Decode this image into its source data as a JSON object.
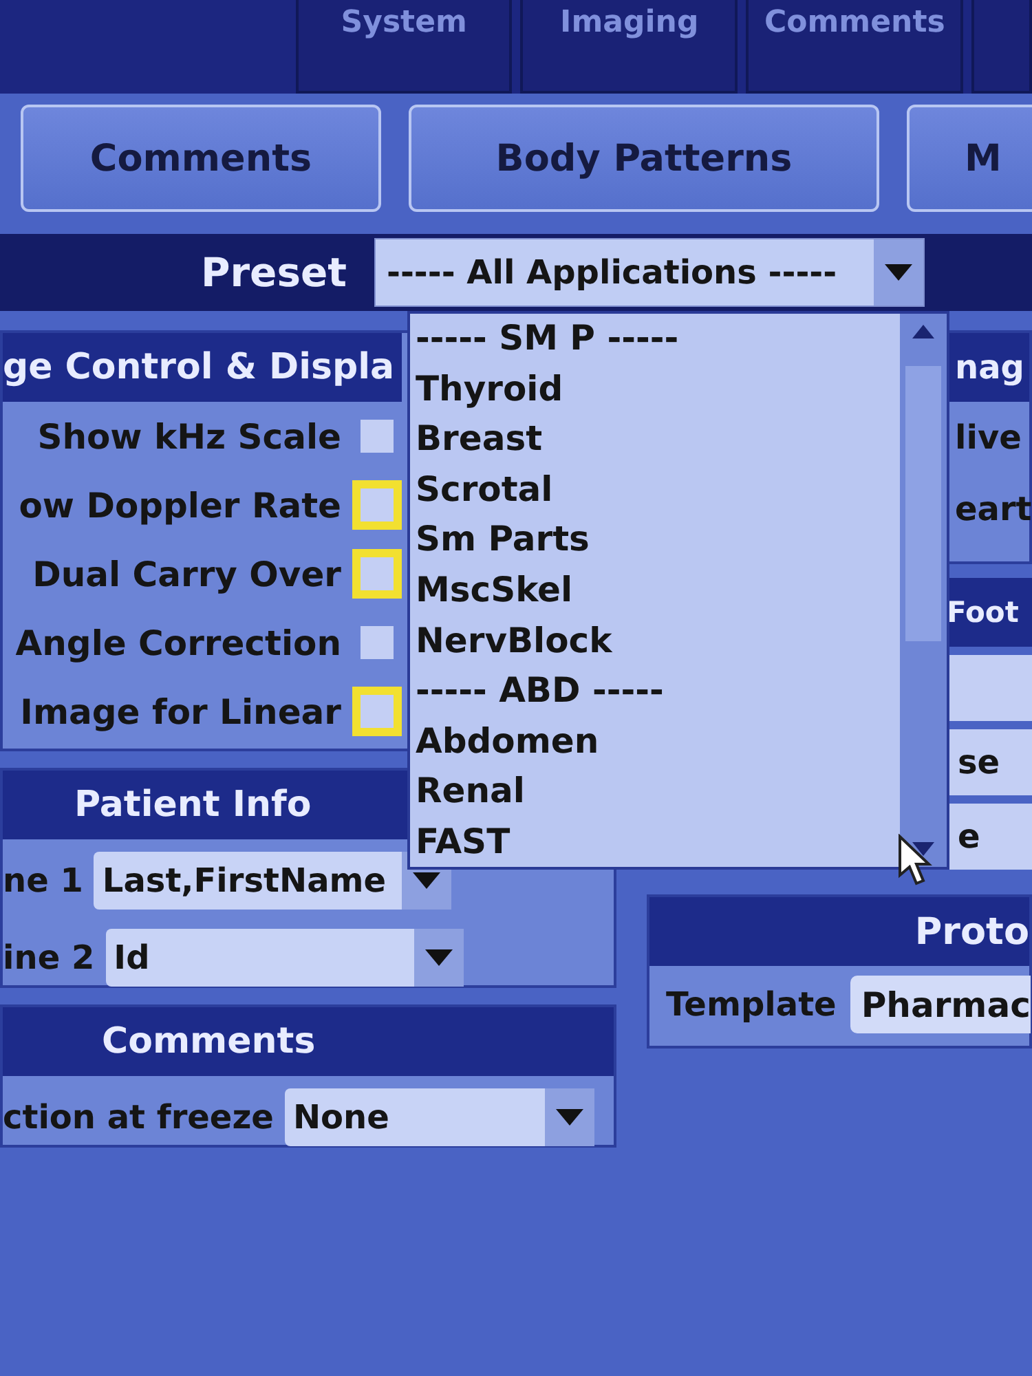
{
  "top_tabs": [
    {
      "label": "System"
    },
    {
      "label": "Imaging"
    },
    {
      "label": "Comments"
    }
  ],
  "buttons": [
    "Comments",
    "Body Patterns",
    "M"
  ],
  "preset": {
    "label": "Preset",
    "value": "----- All Applications -----",
    "expanded": true,
    "options": [
      "----- SM P -----",
      "Thyroid",
      "Breast",
      "Scrotal",
      "Sm Parts",
      "MscSkel",
      "NervBlock",
      "----- ABD -----",
      "Abdomen",
      "Renal",
      "FAST"
    ]
  },
  "image_control": {
    "title": "ge Control & Displa",
    "options": [
      {
        "label": "Show kHz Scale",
        "checked": false,
        "highlighted": false
      },
      {
        "label": "ow Doppler Rate",
        "checked": false,
        "highlighted": true
      },
      {
        "label": "Dual Carry Over",
        "checked": false,
        "highlighted": true
      },
      {
        "label": "Angle Correction",
        "checked": false,
        "highlighted": false
      },
      {
        "label": "Image for Linear",
        "checked": false,
        "highlighted": true
      }
    ]
  },
  "right_panel": {
    "title": "nag",
    "items": [
      "live",
      "eart"
    ]
  },
  "footswitch": {
    "title": "Foot",
    "fields": [
      {
        "kind": "blank"
      },
      {
        "kind": "field",
        "value": "se"
      },
      {
        "kind": "field",
        "value": "e"
      }
    ]
  },
  "patient_info": {
    "title": "Patient Info",
    "lines": [
      {
        "label": "ne 1",
        "value": "Last,FirstName"
      },
      {
        "label": "ine 2",
        "value": "Id"
      }
    ]
  },
  "comments": {
    "title": "Comments",
    "label": "ction at freeze",
    "value": "None"
  },
  "protocol": {
    "title": "Proto",
    "label": "Template",
    "value": "Pharmac"
  }
}
